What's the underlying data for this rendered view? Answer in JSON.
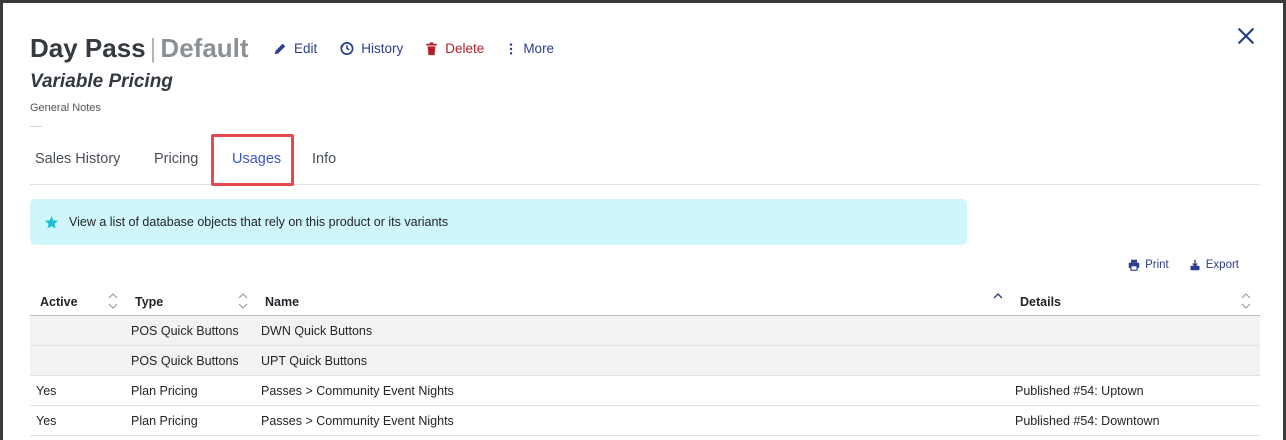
{
  "header": {
    "product_name": "Day Pass",
    "separator": "|",
    "variant_name": "Default",
    "subtitle": "Variable Pricing",
    "notes_label": "General Notes"
  },
  "actions": {
    "edit": "Edit",
    "history": "History",
    "delete": "Delete",
    "more": "More"
  },
  "tabs": [
    {
      "label": "Sales History"
    },
    {
      "label": "Pricing"
    },
    {
      "label": "Usages"
    },
    {
      "label": "Info"
    }
  ],
  "active_tab": "Usages",
  "alert": {
    "icon": "star-icon",
    "text": "View a list of database objects that rely on this product or its variants"
  },
  "tools": {
    "print": "Print",
    "export": "Export"
  },
  "table": {
    "columns": [
      "Active",
      "Type",
      "Name",
      "Details"
    ],
    "rows": [
      {
        "active": "",
        "type": "POS Quick Buttons",
        "name": "DWN Quick Buttons",
        "details": ""
      },
      {
        "active": "",
        "type": "POS Quick Buttons",
        "name": "UPT Quick Buttons",
        "details": ""
      },
      {
        "active": "Yes",
        "type": "Plan Pricing",
        "name": "Passes > Community Event Nights",
        "details": "Published #54: Uptown"
      },
      {
        "active": "Yes",
        "type": "Plan Pricing",
        "name": "Passes > Community Event Nights",
        "details": "Published #54: Downtown"
      }
    ]
  },
  "colors": {
    "accent": "#3b56c4",
    "danger": "#b3202c",
    "alert_bg": "#cff6fb",
    "highlight": "#e5484d"
  }
}
